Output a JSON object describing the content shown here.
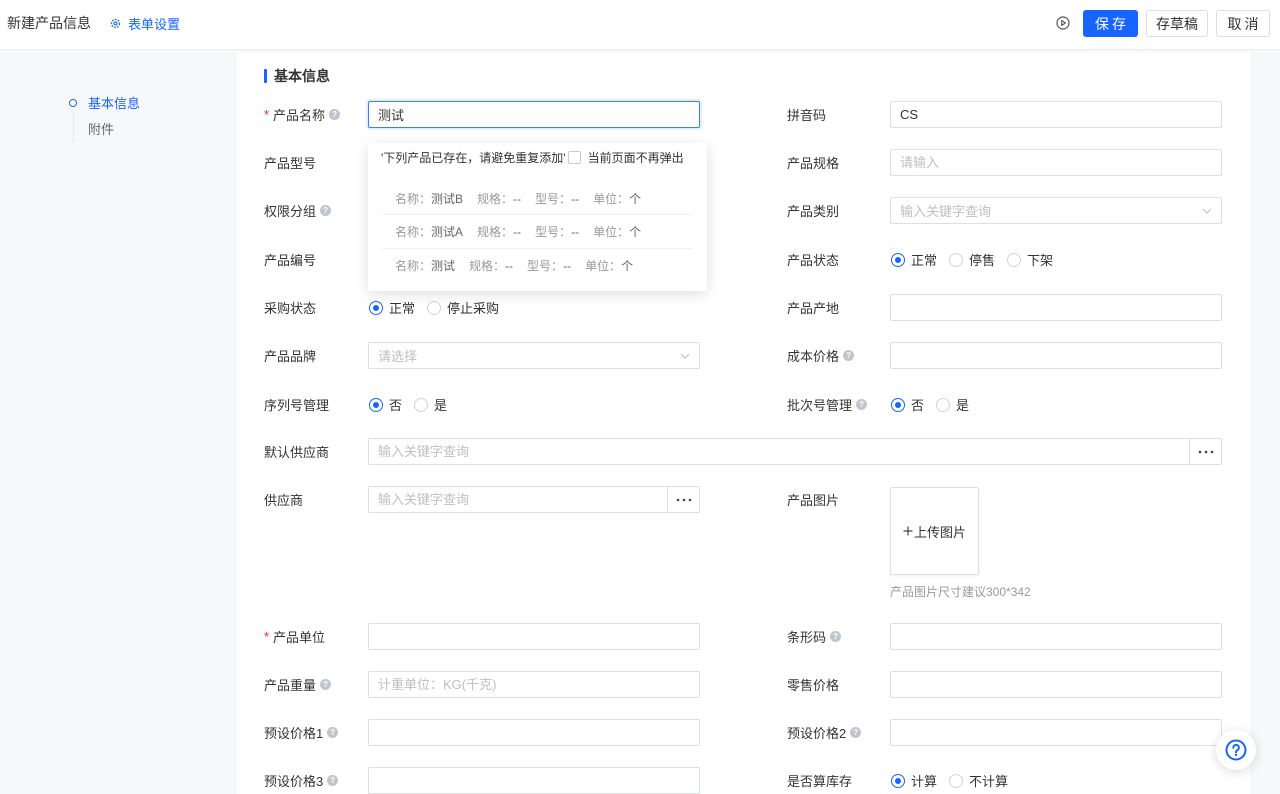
{
  "theme": {
    "primary": "#1764ff",
    "required": "#f5222d"
  },
  "icons": {
    "form_settings": "gear-icon",
    "preview": "play-circle-icon",
    "field_help": "question-circle-icon",
    "picker": "ellipsis-icon",
    "upload": "plus-icon",
    "dropdown": "chevron-down-icon",
    "help_center": "question-circle-icon"
  },
  "header": {
    "title": "新建产品信息",
    "form_settings_label": "表单设置",
    "save_label": "保存",
    "draft_label": "存草稿",
    "cancel_label": "取消"
  },
  "anchor_nav": {
    "items": [
      {
        "label": "基本信息",
        "active": true
      },
      {
        "label": "附件",
        "active": false
      }
    ]
  },
  "section": {
    "title": "基本信息"
  },
  "form": {
    "product_name": {
      "label": "产品名称",
      "required": true,
      "help": true,
      "value": "测试",
      "focused": true
    },
    "pinyin_code": {
      "label": "拼音码",
      "value": "CS"
    },
    "product_model": {
      "label": "产品型号"
    },
    "product_spec": {
      "label": "产品规格",
      "placeholder": "请输入"
    },
    "permission_group": {
      "label": "权限分组",
      "help": true
    },
    "product_category": {
      "label": "产品类别",
      "placeholder": "输入关键字查询"
    },
    "product_code": {
      "label": "产品编号"
    },
    "product_status": {
      "label": "产品状态",
      "options": [
        "正常",
        "停售",
        "下架"
      ],
      "selected": 0
    },
    "purchase_status": {
      "label": "采购状态",
      "options": [
        "正常",
        "停止采购"
      ],
      "selected": 0
    },
    "origin": {
      "label": "产品产地"
    },
    "brand": {
      "label": "产品品牌",
      "placeholder": "请选择"
    },
    "cost_price": {
      "label": "成本价格",
      "help": true
    },
    "serial_mgmt": {
      "label": "序列号管理",
      "options": [
        "否",
        "是"
      ],
      "selected": 0
    },
    "batch_mgmt": {
      "label": "批次号管理",
      "help": true,
      "options": [
        "否",
        "是"
      ],
      "selected": 0
    },
    "default_supplier": {
      "label": "默认供应商",
      "placeholder": "输入关键字查询"
    },
    "supplier": {
      "label": "供应商",
      "placeholder": "输入关键字查询"
    },
    "product_image": {
      "label": "产品图片",
      "upload_label": "上传图片",
      "hint": "产品图片尺寸建议300*342"
    },
    "product_unit": {
      "label": "产品单位",
      "required": true
    },
    "barcode": {
      "label": "条形码",
      "help": true
    },
    "weight": {
      "label": "产品重量",
      "help": true,
      "placeholder": "计重单位：KG(千克)"
    },
    "retail_price": {
      "label": "零售价格"
    },
    "preset_price_1": {
      "label": "预设价格1",
      "help": true
    },
    "preset_price_2": {
      "label": "预设价格2",
      "help": true
    },
    "preset_price_3": {
      "label": "预设价格3",
      "help": true
    },
    "count_inventory": {
      "label": "是否算库存",
      "options": [
        "计算",
        "不计算"
      ],
      "selected": 0
    }
  },
  "duplicate_popover": {
    "message": "'下列产品已存在，请避免重复添加'",
    "dont_show_label": "当前页面不再弹出",
    "dont_show_checked": false,
    "field_labels": {
      "name": "名称：",
      "spec": "规格：",
      "model": "型号：",
      "unit": "单位："
    },
    "items": [
      {
        "name": "测试B",
        "spec": "--",
        "model": "--",
        "unit": "个"
      },
      {
        "name": "测试A",
        "spec": "--",
        "model": "--",
        "unit": "个"
      },
      {
        "name": "测试",
        "spec": "--",
        "model": "--",
        "unit": "个"
      }
    ]
  }
}
